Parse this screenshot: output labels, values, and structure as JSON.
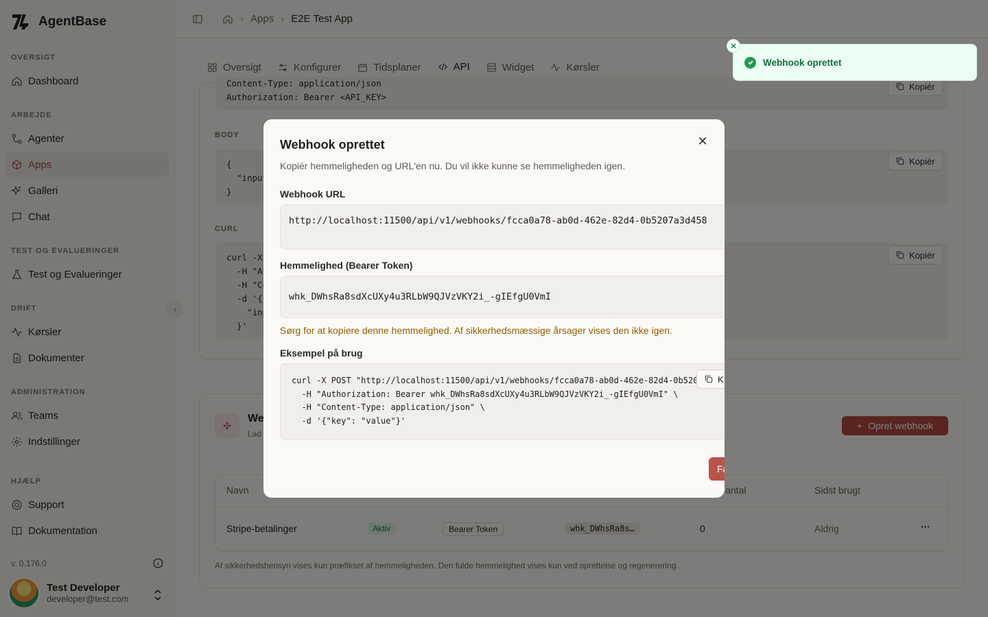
{
  "app": {
    "name": "AgentBase",
    "version": "v. 0.176.0"
  },
  "sidebar": {
    "sections": [
      {
        "title": "OVERSIGT"
      },
      {
        "title": "ARBEJDE"
      },
      {
        "title": "TEST OG EVALUERINGER"
      },
      {
        "title": "DRIFT"
      },
      {
        "title": "ADMINISTRATION"
      },
      {
        "title": "HJÆLP"
      }
    ],
    "items": [
      {
        "label": "Dashboard",
        "icon": "home-icon"
      },
      {
        "label": "Agenter",
        "icon": "agents-icon"
      },
      {
        "label": "Apps",
        "icon": "box-icon",
        "active": true
      },
      {
        "label": "Galleri",
        "icon": "sparkles-icon"
      },
      {
        "label": "Chat",
        "icon": "chat-icon"
      },
      {
        "label": "Test og Evalueringer",
        "icon": "flask-icon"
      },
      {
        "label": "Kørsler",
        "icon": "activity-icon"
      },
      {
        "label": "Dokumenter",
        "icon": "document-icon"
      },
      {
        "label": "Teams",
        "icon": "users-icon"
      },
      {
        "label": "Indstillinger",
        "icon": "gear-icon"
      },
      {
        "label": "Support",
        "icon": "lifebuoy-icon"
      },
      {
        "label": "Dokumentation",
        "icon": "book-icon"
      }
    ],
    "user": {
      "name": "Test Developer",
      "email": "developer@test.com"
    }
  },
  "breadcrumb": {
    "items": [
      "Apps",
      "E2E Test App"
    ]
  },
  "tabs": [
    {
      "label": "Oversigt",
      "icon": "grid-icon"
    },
    {
      "label": "Konfigurer",
      "icon": "sliders-icon"
    },
    {
      "label": "Tidsplaner",
      "icon": "calendar-icon"
    },
    {
      "label": "API",
      "icon": "code-icon",
      "active": true
    },
    {
      "label": "Widget",
      "icon": "layout-icon"
    },
    {
      "label": "Kørsler",
      "icon": "activity-icon"
    }
  ],
  "background": {
    "headers_code": "Content-Type: application/json\nAuthorization: Bearer <API_KEY>",
    "body_label": "BODY",
    "body_code": "{\n  \"input\n}",
    "curl_label": "CURL",
    "curl_code": "curl -X\n  -H \"Au\n  -H \"Co\n  -d '{\n    \"inp\n  }'",
    "copy_label": "Kopiér",
    "webhooks_title": "We",
    "webhooks_sub": "Lad",
    "create_webhook_label": "Opret webhook",
    "table": {
      "headers": [
        "Navn",
        "er-antal",
        "Sidst brugt"
      ],
      "row": {
        "name": "Stripe-betalinger",
        "status": "Aktiv",
        "auth": "Bearer Token",
        "prefix": "whk_DWhsRa8s…",
        "count": "0",
        "last_used": "Aldrig"
      }
    },
    "footnote": "Af sikkerhedshensyn vises kun præfikset af hemmeligheden. Den fulde hemmelighed vises kun ved oprettelse og regenerering."
  },
  "modal": {
    "title": "Webhook oprettet",
    "description": "Kopiér hemmeligheden og URL'en nu. Du vil ikke kunne se hemmeligheden igen.",
    "url_label": "Webhook URL",
    "url_value": "http://localhost:11500/api/v1/webhooks/fcca0a78-ab0d-462e-82d4-0b5207a3d458",
    "secret_label": "Hemmelighed (Bearer Token)",
    "secret_value": "whk_DWhsRa8sdXcUXy4u3RLbW9QJVzVKY2i_-gIEfgU0VmI",
    "warning": "Sørg for at kopiere denne hemmelighed. Af sikkerhedsmæssige årsager vises den ikke igen.",
    "example_label": "Eksempel på brug",
    "example_code": "curl -X POST \"http://localhost:11500/api/v1/webhooks/fcca0a78-ab0d-462e-82d4-0b520\n  -H \"Authorization: Bearer whk_DWhsRa8sdXcUXy4u3RLbW9QJVzVKY2i_-gIEfgU0VmI\" \\\n  -H \"Content-Type: application/json\" \\\n  -d '{\"key\": \"value\"}'",
    "copy_label": "K",
    "done_label": "Fa"
  },
  "toast": {
    "message": "Webhook oprettet"
  },
  "colors": {
    "accent": "#b14a42",
    "success": "#1f9a55"
  }
}
